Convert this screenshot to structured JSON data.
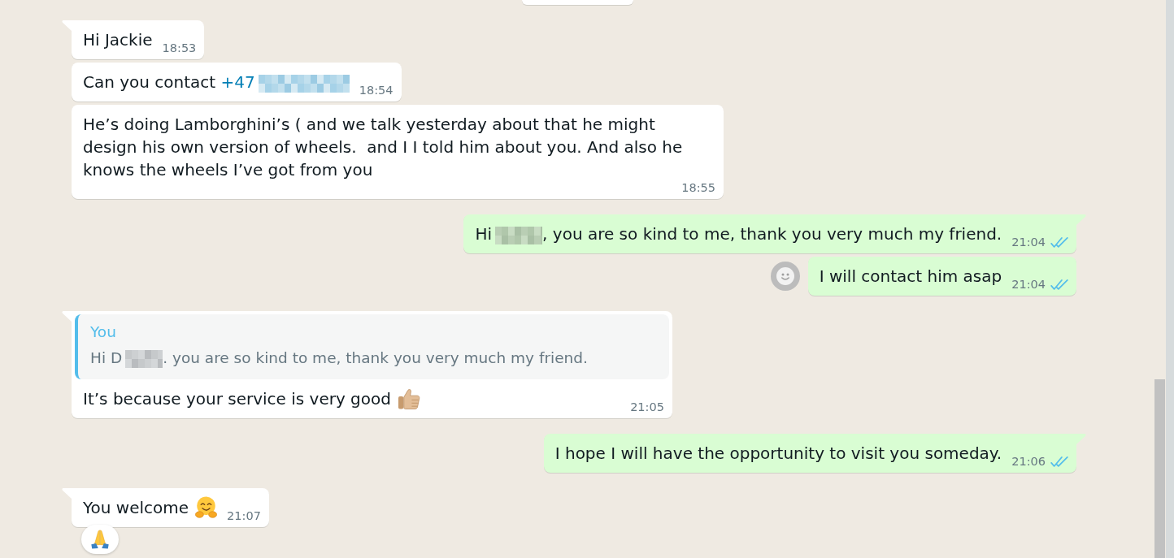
{
  "chat": {
    "messages": [
      {
        "kind": "incoming",
        "hovered": false,
        "parts": [
          {
            "kind": "text",
            "text": "Hi Jackie"
          }
        ],
        "time": "18:53"
      },
      {
        "kind": "incoming",
        "hovered": false,
        "parts": [
          {
            "kind": "text",
            "text": "Can you contact"
          },
          {
            "kind": "link",
            "text": "+47"
          },
          {
            "kind": "redaction"
          }
        ],
        "time": "18:54"
      },
      {
        "kind": "incoming",
        "hovered": false,
        "parts": [
          {
            "kind": "text",
            "text": "He’s doing Lamborghini’s ( and we talk yesterday about that he might design his own version of wheels.  and I I told him about you. And also he knows the wheels I’ve got from you"
          }
        ],
        "time": "18:55"
      },
      {
        "kind": "outgoing",
        "hovered": false,
        "parts": [
          {
            "kind": "text",
            "text": "Hi"
          },
          {
            "kind": "redaction"
          },
          {
            "kind": "text",
            "text": ", you are so kind to me, thank you very much my friend."
          }
        ],
        "time": "21:04",
        "read": true
      },
      {
        "kind": "outgoing",
        "hovered": true,
        "parts": [
          {
            "kind": "text",
            "text": "I will contact him asap"
          }
        ],
        "time": "21:04",
        "read": true
      },
      {
        "kind": "incoming",
        "hovered": false,
        "quote": {
          "author": "You",
          "parts": [
            {
              "kind": "text",
              "text": "Hi D"
            },
            {
              "kind": "redaction"
            },
            {
              "kind": "text",
              "text": ". you are so kind to me, thank you very much my friend."
            }
          ]
        },
        "parts": [
          {
            "kind": "text",
            "text": "It’s because your service is very good"
          },
          {
            "kind": "thumbsup"
          }
        ],
        "time": "21:05"
      },
      {
        "kind": "outgoing",
        "hovered": false,
        "parts": [
          {
            "kind": "text",
            "text": "I hope I will have the opportunity to visit you someday."
          }
        ],
        "time": "21:06",
        "read": true
      },
      {
        "kind": "incoming",
        "hovered": false,
        "parts": [
          {
            "kind": "text",
            "text": "You welcome"
          },
          {
            "kind": "hugging"
          }
        ],
        "time": "21:07",
        "reactions": [
          {
            "kind": "pray"
          }
        ]
      }
    ]
  }
}
